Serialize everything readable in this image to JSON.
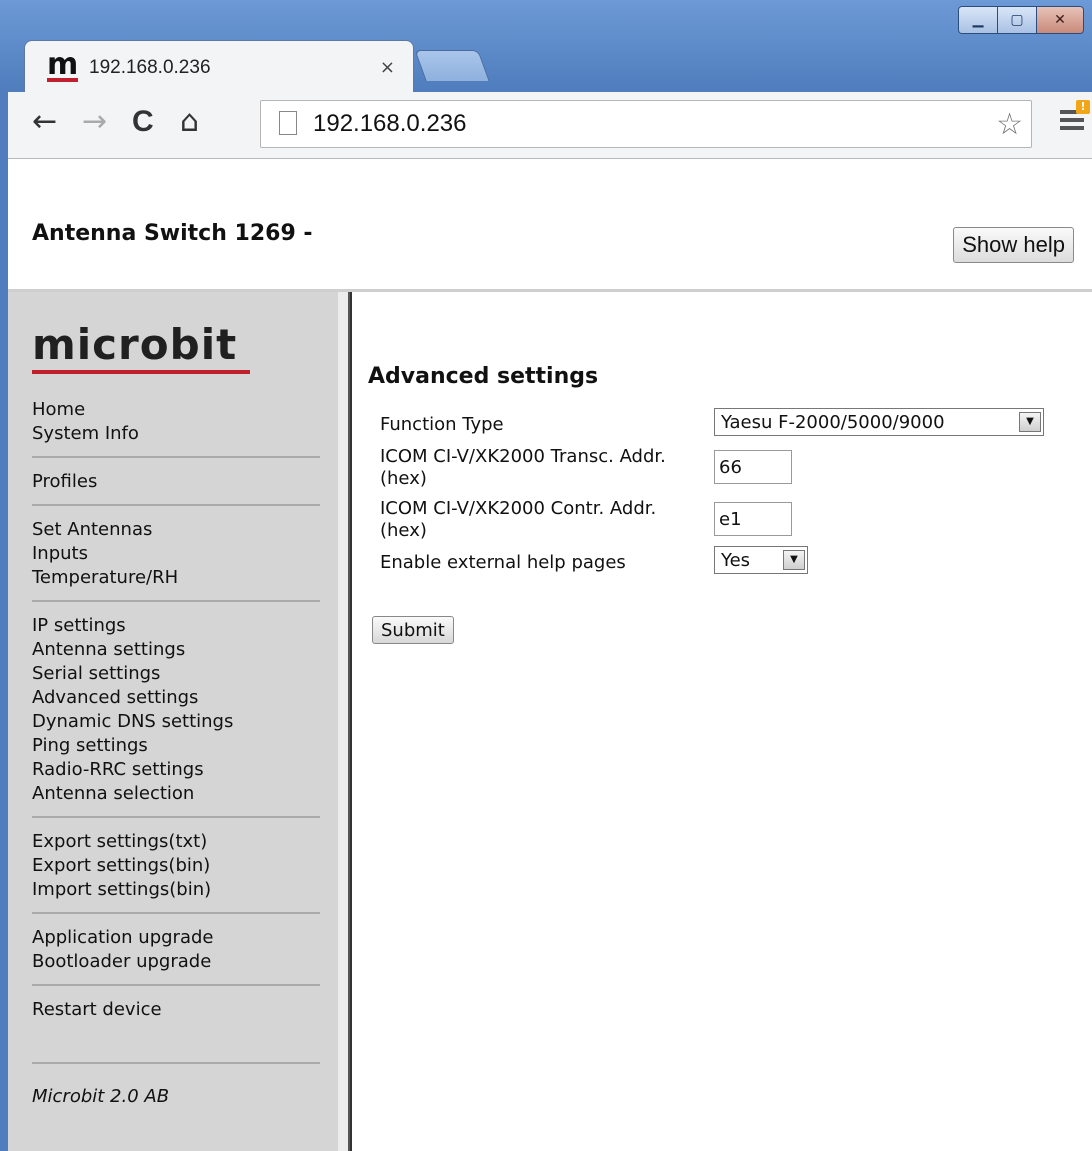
{
  "browser": {
    "tab_title": "192.168.0.236",
    "tab_favicon": "m",
    "tab_close": "×",
    "url": "192.168.0.236",
    "nav": {
      "back": "←",
      "forward": "→",
      "reload": "C",
      "home": "⌂"
    },
    "star": "☆",
    "menu_badge": "!"
  },
  "header": {
    "title": "Antenna Switch 1269 -",
    "help_button": "Show help"
  },
  "sidebar": {
    "logo": "microbit",
    "groups": [
      [
        "Home",
        "System Info"
      ],
      [
        "Profiles"
      ],
      [
        "Set Antennas",
        "Inputs",
        "Temperature/RH"
      ],
      [
        "IP settings",
        "Antenna settings",
        "Serial settings",
        "Advanced settings",
        "Dynamic DNS settings",
        "Ping settings",
        "Radio-RRC settings",
        "Antenna selection"
      ],
      [
        "Export settings(txt)",
        "Export settings(bin)",
        "Import settings(bin)"
      ],
      [
        "Application upgrade",
        "Bootloader upgrade"
      ],
      [
        "Restart device"
      ]
    ],
    "footer": "Microbit 2.0 AB"
  },
  "main": {
    "heading": "Advanced settings",
    "fields": {
      "function_type": {
        "label": "Function Type",
        "value": "Yaesu F-2000/5000/9000"
      },
      "transc_addr": {
        "label": "ICOM CI-V/XK2000 Transc. Addr.(hex)",
        "value": "66"
      },
      "contr_addr": {
        "label": "ICOM CI-V/XK2000 Contr. Addr.(hex)",
        "value": "e1"
      },
      "help_pages": {
        "label": "Enable external help pages",
        "value": "Yes"
      }
    },
    "submit": "Submit"
  }
}
